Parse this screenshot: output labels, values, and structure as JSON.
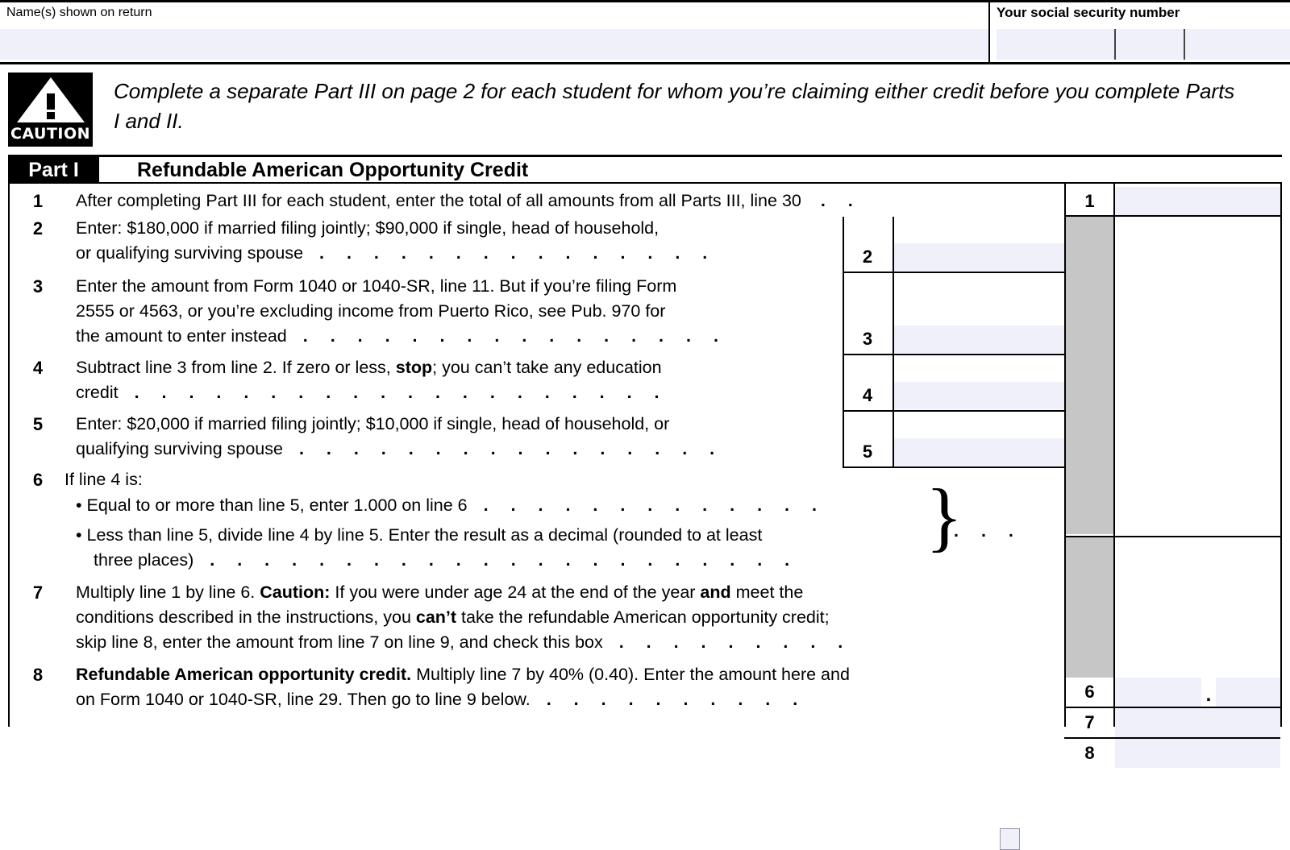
{
  "form": {
    "header": {
      "name_label": "Name(s) shown on return",
      "name_value": "",
      "ssn_label": "Your social security number",
      "ssn_part1": "",
      "ssn_part2": "",
      "ssn_part3": ""
    },
    "caution": {
      "icon_caption": "CAUTION",
      "text": "Complete a separate Part III on page 2 for each student for whom you’re claiming either credit before you complete Parts I and II."
    },
    "part": {
      "tag": "Part I",
      "title": "Refundable American Opportunity Credit"
    },
    "lines": {
      "l1": {
        "num": "1",
        "text": "After completing Part III for each student, enter the total of all amounts from all Parts III, line 30",
        "dots": ".  .",
        "value": ""
      },
      "l2": {
        "num": "2",
        "text_a": "Enter: $180,000 if married filing jointly; $90,000 if single, head of household,",
        "text_b": "or qualifying surviving spouse",
        "dots": ". . . . . . . . . . . . . . .",
        "value": ""
      },
      "l3": {
        "num": "3",
        "text_a": "Enter the amount from Form 1040 or 1040-SR, line 11. But if you’re filing Form",
        "text_b": "2555 or 4563, or you’re excluding income from Puerto Rico, see Pub. 970 for",
        "text_c": "the amount to enter instead",
        "dots": ". . . . . . . . . . . . . . . .",
        "value": ""
      },
      "l4": {
        "num": "4",
        "text_a_1": "Subtract line 3 from line 2. If zero or less, ",
        "text_a_bold": "stop",
        "text_a_2": "; you can’t take any education",
        "text_b": "credit",
        "dots": ". . . . . . . . . . . . . . . . . . . .",
        "value": ""
      },
      "l5": {
        "num": "5",
        "text_a": "Enter: $20,000 if married filing jointly; $10,000 if single, head of household, or",
        "text_b": "qualifying surviving spouse",
        "dots": ". . . . . . . . . . . . . . . .",
        "value": ""
      },
      "l6": {
        "num": "6",
        "intro": "If line 4 is:",
        "bullet1": "• Equal to or more than line 5, enter 1.000 on line 6",
        "bullet1_dots": ". . . . . . . . . . . . .",
        "bullet2_a": "• Less than line 5, divide line 4 by line 5. Enter the result as a decimal (rounded to at least",
        "bullet2_b": "three places)",
        "bullet2_dots": ". . . . . . . . . . . . . . . . . . . . . .",
        "outer_dots": ".  .  .",
        "brace": "}",
        "value_whole": "",
        "decimal_point": ".",
        "value_frac": ""
      },
      "l7": {
        "num": "7",
        "text_a_1": "Multiply line 1 by line 6. ",
        "text_a_bold": "Caution:",
        "text_a_2": " If you were under age 24 at the end of the year ",
        "text_a_bold2": "and",
        "text_a_3": " meet the",
        "text_b_1": "conditions described in the instructions, you ",
        "text_b_bold": "can’t",
        "text_b_2": " take the refundable American opportunity credit;",
        "text_c": "skip line 8, enter the amount from line 7 on line 9, and check this box",
        "dots": ". . . . . . . . .",
        "checkbox_checked": false,
        "value": ""
      },
      "l8": {
        "num": "8",
        "text_a_bold": "Refundable American opportunity credit.",
        "text_a_2": " Multiply line 7 by 40% (0.40). Enter the amount here and",
        "text_b": "on Form 1040 or 1040-SR, line 29. Then go to line 9 below.",
        "dots": ". . . . . . . . . .",
        "value": ""
      }
    }
  },
  "colors": {
    "field_fill": "#eff0fa",
    "shaded_column": "#c6c6c6",
    "rule": "#000000"
  }
}
